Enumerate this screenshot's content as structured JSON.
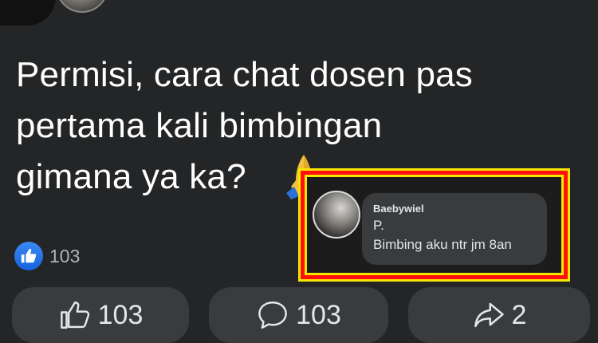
{
  "post": {
    "lines": [
      "Permisi, cara chat dosen pas",
      "pertama kali bimbingan",
      "gimana ya ka?"
    ]
  },
  "reactions": {
    "icon": "like-icon",
    "count": "103"
  },
  "comment": {
    "author": "Baebywiel",
    "line1": "P.",
    "line2": "Bimbing aku ntr jm 8an"
  },
  "actions": {
    "like_count": "103",
    "comment_count": "103",
    "share_count": "2"
  },
  "colors": {
    "background": "#242526",
    "bubble": "#3a3b3c",
    "highlight_border": "#ff1010",
    "highlight_glow": "#f5e600",
    "like_blue": "#1877f2"
  }
}
